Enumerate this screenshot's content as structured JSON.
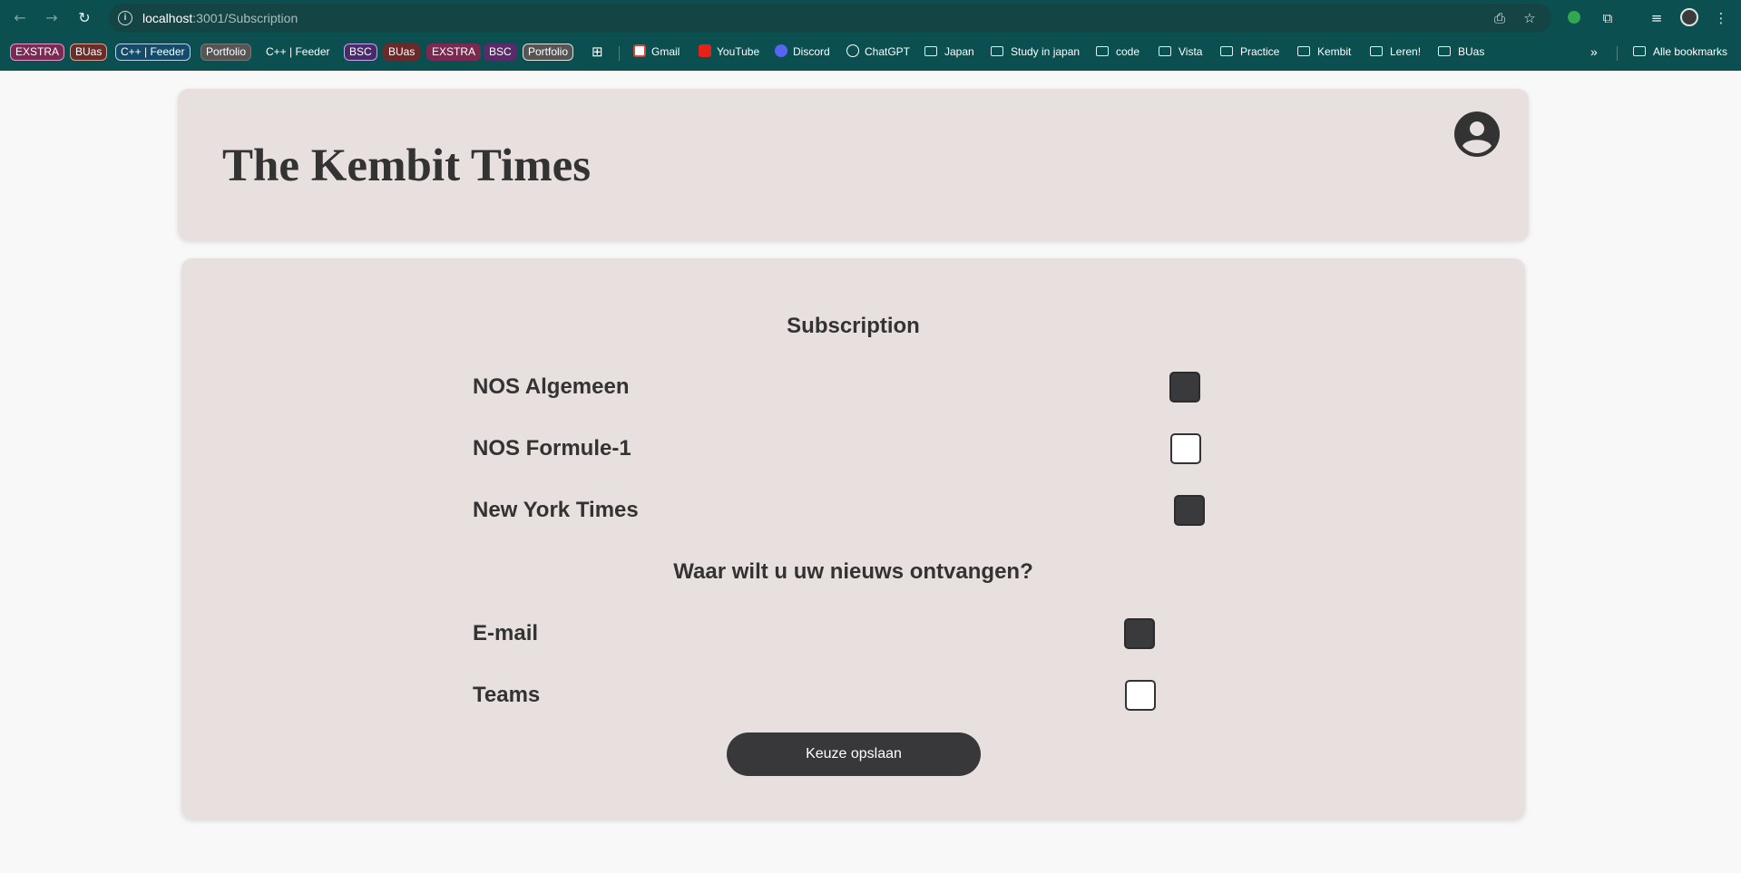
{
  "browser": {
    "url_host": "localhost",
    "url_path": ":3001/Subscription"
  },
  "bookmarks": {
    "pills": [
      {
        "label": "EXSTRA",
        "bg": "#7a2a55",
        "border": "#e59bc6"
      },
      {
        "label": "BUas",
        "bg": "#6a2e2a",
        "border": "#e0a08f"
      },
      {
        "label": "C++ | Feeder",
        "bg": "#134b6a",
        "border": "#b9d4e6"
      },
      {
        "label": "Portfolio",
        "bg": "#555555",
        "border": "#777777"
      },
      {
        "label": "C++ | Feeder",
        "bg": "#0b4f50",
        "border": "#0b4f50"
      },
      {
        "label": "BSC",
        "bg": "#4a2a6a",
        "border": "#c9a6f0"
      },
      {
        "label": "BUas",
        "bg": "#6a2a2a",
        "border": "#6a2a2a"
      },
      {
        "label": "EXSTRA",
        "bg": "#7a2a50",
        "border": "#7a2a50"
      },
      {
        "label": "BSC",
        "bg": "#5a2a6a",
        "border": "#5a2a6a"
      },
      {
        "label": "Portfolio",
        "bg": "#555555",
        "border": "#e0e0e0"
      }
    ],
    "links": [
      {
        "label": "Gmail",
        "icon": "gmail-icon"
      },
      {
        "label": "YouTube",
        "icon": "youtube-icon"
      },
      {
        "label": "Discord",
        "icon": "discord-icon"
      },
      {
        "label": "ChatGPT",
        "icon": "chatgpt-icon"
      }
    ],
    "folders": [
      "Japan",
      "Study in japan",
      "code",
      "Vista",
      "Practice",
      "Kembit",
      "Leren!",
      "BUas"
    ],
    "all_bookmarks": "Alle bookmarks"
  },
  "header": {
    "title": "The Kembit Times"
  },
  "subscription": {
    "title": "Subscription",
    "items": [
      {
        "label": "NOS Algemeen",
        "checked": true
      },
      {
        "label": "NOS Formule-1",
        "checked": false
      },
      {
        "label": "New York Times",
        "checked": true
      }
    ]
  },
  "delivery": {
    "title": "Waar wilt u uw nieuws ontvangen?",
    "items": [
      {
        "label": "E-mail",
        "checked": true
      },
      {
        "label": "Teams",
        "checked": false
      }
    ]
  },
  "save_label": "Keuze opslaan",
  "colors": {
    "chrome": "#0b4f50",
    "card": "#e8e0df",
    "text": "#333333",
    "checkbox_checked": "#3a3a3c",
    "button": "#38373a"
  }
}
